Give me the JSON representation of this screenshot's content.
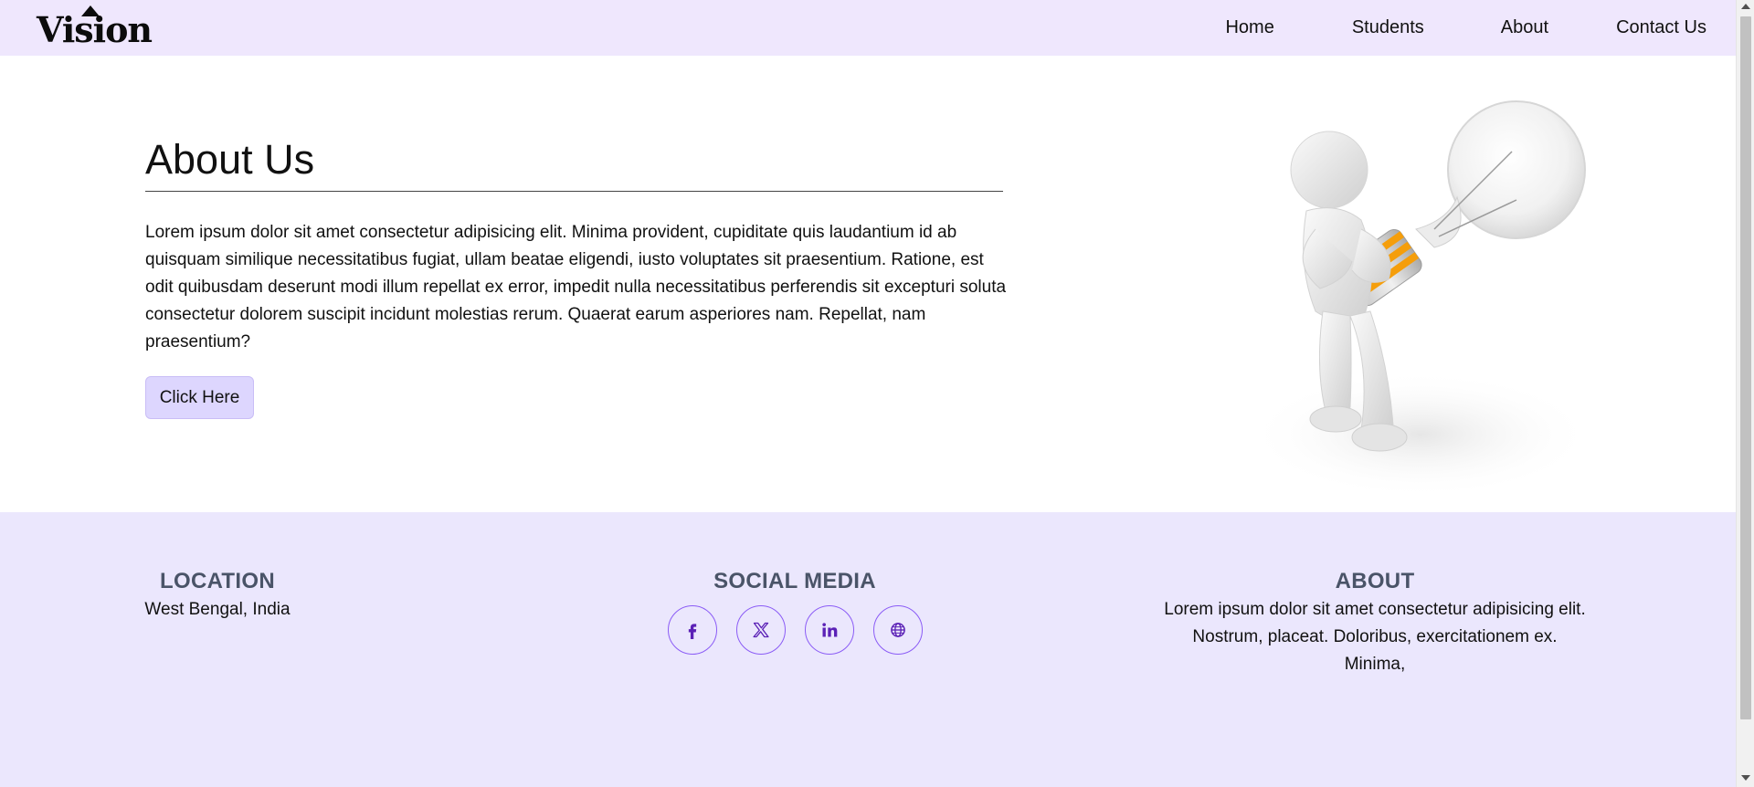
{
  "brand": {
    "logo_text": "Vision"
  },
  "nav": {
    "items": [
      {
        "label": "Home"
      },
      {
        "label": "Students"
      },
      {
        "label": "About"
      },
      {
        "label": "Contact Us"
      }
    ]
  },
  "about": {
    "title": "About Us",
    "body": "Lorem ipsum dolor sit amet consectetur adipisicing elit. Minima provident, cupiditate quis laudantium id ab quisquam similique necessitatibus fugiat, ullam beatae eligendi, iusto voluptates sit praesentium. Ratione, est odit quibusdam deserunt modi illum repellat ex error, impedit nulla necessitatibus perferendis sit excepturi soluta consectetur dolorem suscipit incidunt molestias rerum. Quaerat earum asperiores nam. Repellat, nam praesentium?",
    "button_label": "Click Here",
    "image_icon": "person-holding-lightbulb"
  },
  "footer": {
    "location": {
      "heading": "LOCATION",
      "text": "West Bengal, India"
    },
    "social": {
      "heading": "SOCIAL MEDIA",
      "icons": [
        "facebook-icon",
        "x-twitter-icon",
        "linkedin-icon",
        "globe-icon"
      ]
    },
    "about": {
      "heading": "ABOUT",
      "text": "Lorem ipsum dolor sit amet consectetur adipisicing elit. Nostrum, placeat. Doloribus, exercitationem ex. Minima,"
    }
  },
  "colors": {
    "nav_bg": "#efe7fd",
    "footer_bg": "#ebe7fd",
    "button_bg": "#ddd6fe",
    "accent": "#8b5cf6",
    "icon_color": "#5b21b6",
    "footer_heading": "#4a5468"
  }
}
